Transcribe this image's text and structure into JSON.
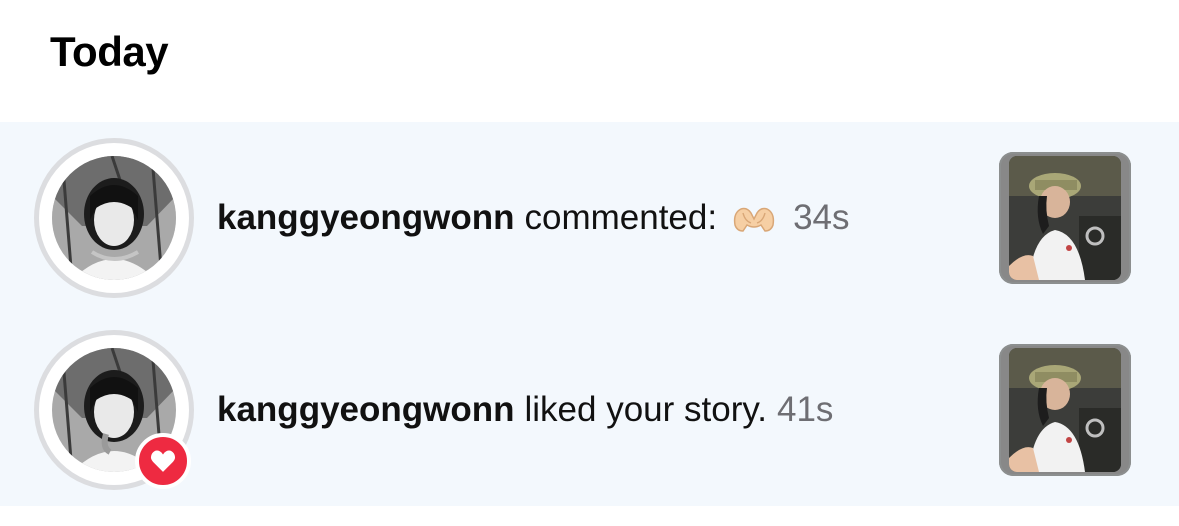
{
  "section": {
    "title": "Today"
  },
  "notifications": [
    {
      "username": "kanggyeongwonn",
      "action": "commented:",
      "emoji": "heart-hands-emoji",
      "time": "34s",
      "badge": null
    },
    {
      "username": "kanggyeongwonn",
      "action": "liked your story.",
      "time": "41s",
      "badge": "heart-icon"
    }
  ],
  "colors": {
    "list_background": "#f3f8fd",
    "heart_badge": "#ee2a41",
    "timestamp": "#6e6e73"
  }
}
